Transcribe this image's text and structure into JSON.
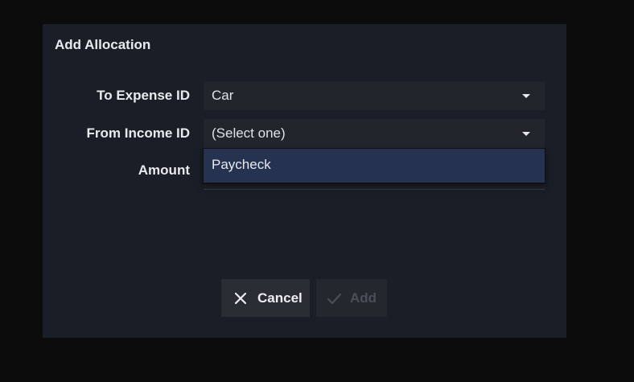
{
  "dialog": {
    "title": "Add Allocation"
  },
  "form": {
    "expense": {
      "label": "To Expense ID",
      "value": "Car"
    },
    "income": {
      "label": "From Income ID",
      "value": "(Select one)",
      "options": [
        "Paycheck"
      ]
    },
    "amount": {
      "label": "Amount",
      "value": ""
    }
  },
  "buttons": {
    "cancel": {
      "label": "Cancel",
      "icon": "close-icon"
    },
    "add": {
      "label": "Add",
      "icon": "check-icon",
      "enabled": false
    }
  },
  "colors": {
    "dialog_bg": "#1a1e26",
    "field_bg": "#22252c",
    "option_highlight": "#263350",
    "disabled_text": "#4a4f58"
  }
}
